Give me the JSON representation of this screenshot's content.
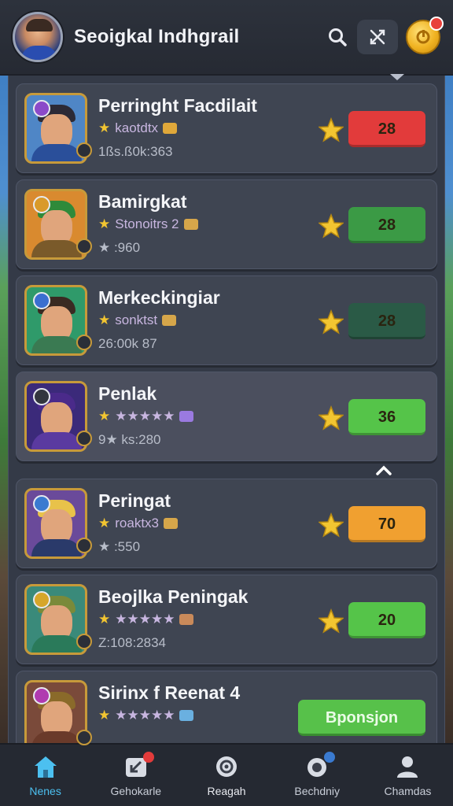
{
  "header": {
    "title": "Seoigkal Indhgrail"
  },
  "rows": [
    {
      "name": "Perringht Facdilait",
      "stat1": "kaotdtx",
      "stat2": "1ßs.ß0k:363",
      "score": "28",
      "score_color": "#e23b3b",
      "badge_color": "#8b4ac9",
      "hair": "#2c2a36",
      "body": "#2a4f9a",
      "bg": "#4f86c6",
      "gem": "#e0a83a"
    },
    {
      "name": "Bamirgkat",
      "stat1": "Stonoitrs 2",
      "stat2": "★ :960",
      "score": "28",
      "score_color": "#3b9a45",
      "badge_color": "#d99a2a",
      "hair": "#2f8a3a",
      "body": "#7a5a2a",
      "bg": "#d98a2f",
      "gem": "#d6a64a"
    },
    {
      "name": "Merkeckingiar",
      "stat1": "sonktst",
      "stat2": "26:00k 87",
      "score": "28",
      "score_color": "#2a5a46",
      "badge_color": "#3a6fd0",
      "hair": "#3a2a22",
      "body": "#3a7a52",
      "bg": "#2f9a6a",
      "gem": "#d6a64a"
    },
    {
      "name": "Penlak",
      "stat1": "★★★★★",
      "stat2": "9★ ks:280",
      "score": "36",
      "score_color": "#55c449",
      "badge_color": "#33363e",
      "hair": "#4a2a8a",
      "body": "#5a3aa0",
      "bg": "#3b2a7a",
      "gem": "#9a7ae0"
    },
    {
      "name": "Peringat",
      "stat1": "roaktx3",
      "stat2": "★ :550",
      "score": "70",
      "score_color": "#f0a030",
      "badge_color": "#3a7ad0",
      "hair": "#e8c24a",
      "body": "#2a3a6a",
      "bg": "#6a4a9a",
      "gem": "#d6a64a"
    },
    {
      "name": "Beojlka Peningak",
      "stat1": "★★★★★",
      "stat2": "Z:108:2834",
      "score": "20",
      "score_color": "#55c449",
      "badge_color": "#d6a62a",
      "hair": "#7a8a3a",
      "body": "#2a7a5a",
      "bg": "#3a8a7a",
      "gem": "#c98a5a"
    },
    {
      "name": "Sirinx f Reenat 4",
      "stat1": "★★★★★",
      "stat2": "",
      "score": "",
      "score_color": "",
      "badge_color": "#b03ab0",
      "hair": "#8a6a2a",
      "body": "#6a3a2a",
      "bg": "#7a4a3a",
      "gem": "#6ab0e0"
    }
  ],
  "sponsor_label": "Bponsjon",
  "nav": [
    {
      "label": "Nenes",
      "active": true
    },
    {
      "label": "Gehokarle",
      "active": false
    },
    {
      "label": "Reagah",
      "active": false
    },
    {
      "label": "Bechdniy",
      "active": false
    },
    {
      "label": "Chamdas",
      "active": false
    }
  ],
  "colors": {
    "accent": "#4cc0f0",
    "star": "#f2c531"
  }
}
